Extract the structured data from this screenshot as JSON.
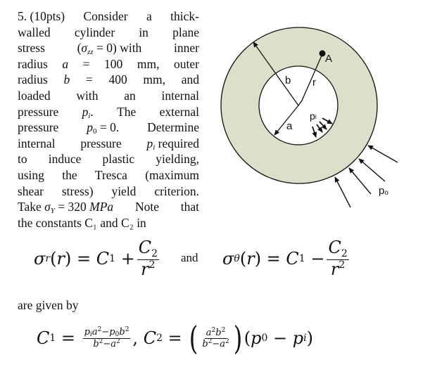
{
  "problem": {
    "lines": [
      [
        "5. (10pts)",
        "Consider",
        "a",
        "thick-"
      ],
      [
        "walled",
        "cylinder",
        "in",
        "plane"
      ],
      [
        "stress",
        "(σ_zz = 0) with",
        "inner"
      ],
      [
        "radius",
        "a",
        "=",
        "100",
        "mm,",
        "outer"
      ],
      [
        "radius",
        "b",
        "=",
        "400",
        "mm,",
        "and"
      ],
      [
        "loaded",
        "with",
        "an",
        "internal"
      ],
      [
        "pressure",
        "p_i.",
        "The",
        "external"
      ],
      [
        "pressure",
        "p_0 = 0.",
        "Determine"
      ],
      [
        "internal",
        "pressure",
        "p_i required"
      ],
      [
        "to",
        "induce",
        "plastic",
        "yielding,"
      ],
      [
        "using",
        "the",
        "Tresca",
        "(maximum"
      ],
      [
        "shear",
        "stress)",
        "yield",
        "criterion."
      ],
      [
        "Take σ_Y = 320 MPa",
        "Note",
        "that"
      ],
      [
        "the constants C₁ and C₂ in"
      ]
    ],
    "number": "5.",
    "points": "(10pts)",
    "inner_radius": "a = 100 mm",
    "outer_radius": "b = 400 mm",
    "external_pressure": "p0 = 0",
    "yield_stress": "σY = 320 MPa",
    "criterion": "Tresca (maximum shear stress)"
  },
  "equations": {
    "sigma_r": "σr(r) = C1 + C2/r²",
    "connector": "and",
    "sigma_theta": "σθ(r) = C1 − C2/r²",
    "given_by": "are given by",
    "c1": "C1 = (pi a² − p0 b²)/(b² − a²)",
    "c2": "C2 = (a² b²/(b² − a²))(p0 − pi)"
  },
  "diagram": {
    "labels": {
      "b": "b",
      "r": "r",
      "a": "a",
      "A": "A",
      "pi": "p",
      "pi_sub": "i",
      "po": "p",
      "po_sub": "o"
    },
    "colors": {
      "annulus_fill": "#dcdfca",
      "stroke": "#111111",
      "hole_fill": "#ffffff"
    }
  }
}
